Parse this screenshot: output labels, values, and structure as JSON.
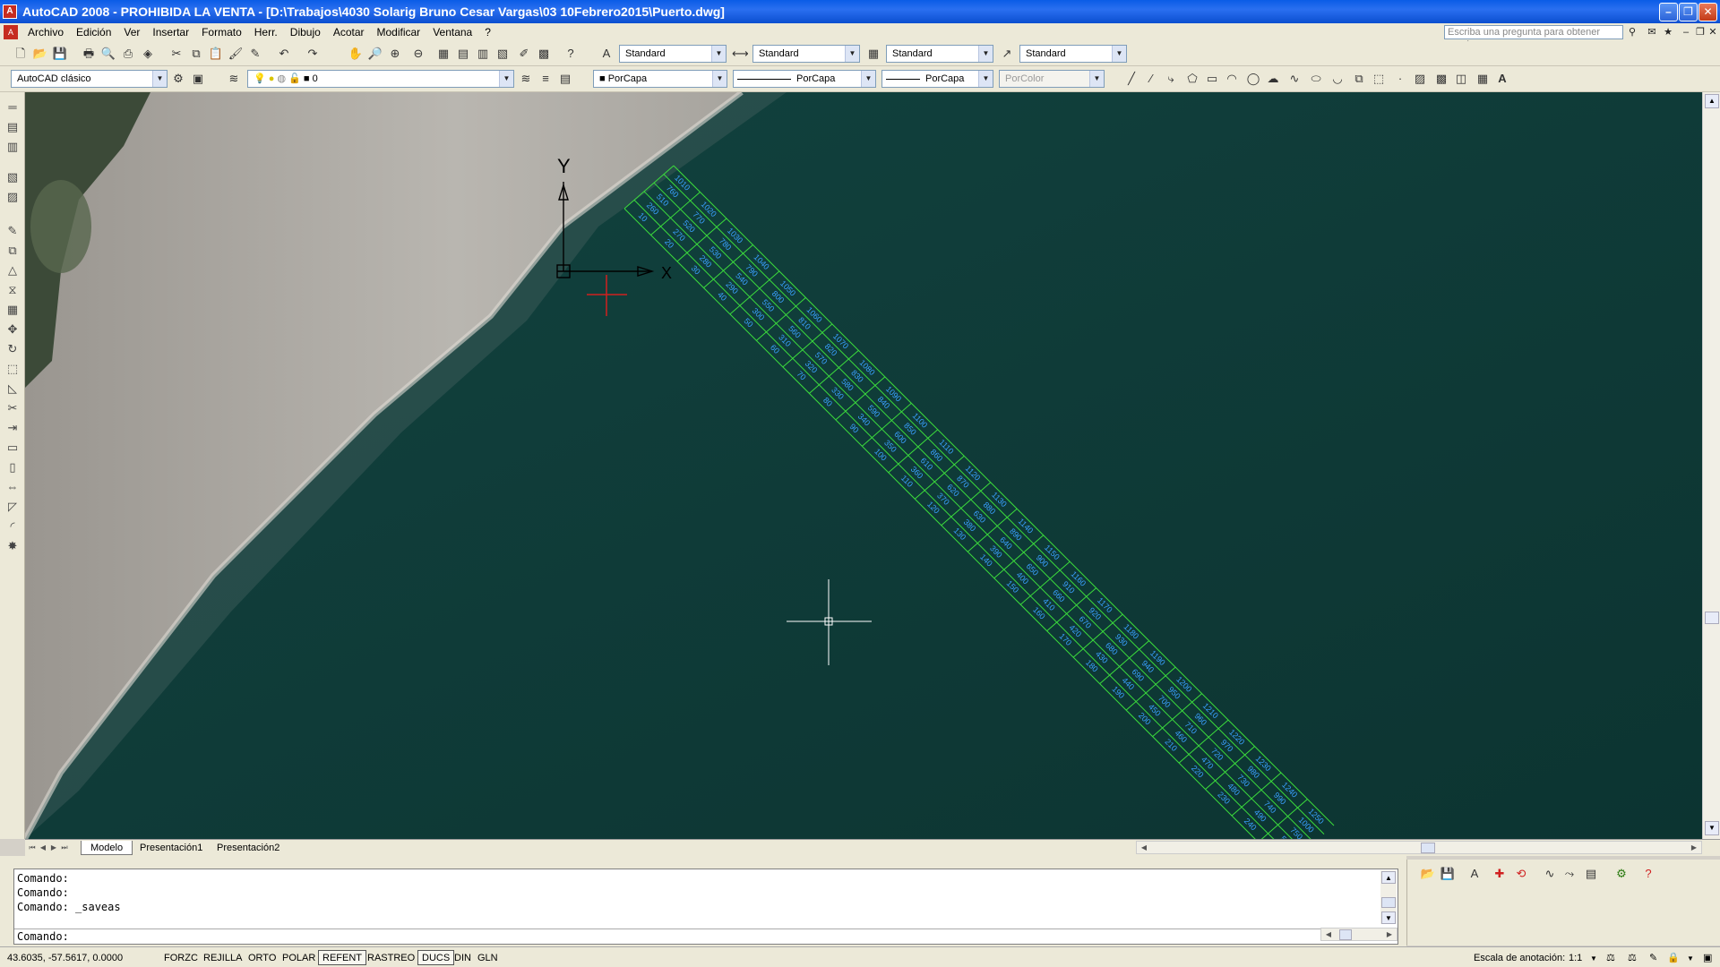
{
  "window": {
    "title": "AutoCAD 2008 - PROHIBIDA LA VENTA - [D:\\Trabajos\\4030 Solarig Bruno Cesar Vargas\\03 10Febrero2015\\Puerto.dwg]",
    "minimize": "–",
    "maximize": "❐",
    "close": "✕"
  },
  "menu": {
    "items": [
      "Archivo",
      "Edición",
      "Ver",
      "Insertar",
      "Formato",
      "Herr.",
      "Dibujo",
      "Acotar",
      "Modificar",
      "Ventana",
      "?"
    ],
    "help_placeholder": "Escriba una pregunta para obtener ayuda"
  },
  "toolbar1": {
    "text_style": "Standard",
    "dim_style": "Standard",
    "table_style": "Standard",
    "multileader_style": "Standard"
  },
  "toolbar2": {
    "workspace": "AutoCAD clásico",
    "layer": "0",
    "color": "PorCapa",
    "linetype": "PorCapa",
    "lineweight": "PorCapa",
    "plotstyle": "PorColor",
    "text_icon": "A"
  },
  "canvas": {
    "ucs_y": "Y",
    "ucs_x": "X",
    "grid_labels": [
      [
        "10",
        "20",
        "30",
        "40",
        "50",
        "60",
        "70",
        "80",
        "90",
        "100",
        "110",
        "120",
        "130",
        "140",
        "150",
        "160",
        "170",
        "180",
        "190",
        "200",
        "210",
        "220",
        "230",
        "240",
        "250"
      ],
      [
        "260",
        "270",
        "280",
        "290",
        "300",
        "310",
        "320",
        "330",
        "340",
        "350",
        "360",
        "370",
        "380",
        "390",
        "400",
        "410",
        "420",
        "430",
        "440",
        "450",
        "460",
        "470",
        "480",
        "490",
        "500"
      ],
      [
        "510",
        "520",
        "530",
        "540",
        "550",
        "560",
        "570",
        "580",
        "590",
        "600",
        "610",
        "620",
        "630",
        "640",
        "650",
        "660",
        "670",
        "680",
        "690",
        "700",
        "710",
        "720",
        "730",
        "740",
        "750"
      ],
      [
        "760",
        "770",
        "780",
        "790",
        "800",
        "810",
        "820",
        "830",
        "840",
        "850",
        "860",
        "870",
        "880",
        "890",
        "900",
        "910",
        "920",
        "930",
        "940",
        "950",
        "960",
        "970",
        "980",
        "990",
        "1000"
      ],
      [
        "1010",
        "1020",
        "1030",
        "1040",
        "1050",
        "1060",
        "1070",
        "1080",
        "1090",
        "1100",
        "1110",
        "1120",
        "1130",
        "1140",
        "1150",
        "1160",
        "1170",
        "1180",
        "1190",
        "1200",
        "1210",
        "1220",
        "1230",
        "1240",
        "1250"
      ]
    ]
  },
  "tabs": [
    "Modelo",
    "Presentación1",
    "Presentación2"
  ],
  "command": {
    "lines": [
      "Comando:",
      "Comando:",
      "Comando:  _saveas"
    ],
    "prompt": "Comando:"
  },
  "status": {
    "coords": "43.6035, -57.5617, 0.0000",
    "toggles": [
      {
        "label": "FORZC",
        "on": false
      },
      {
        "label": "REJILLA",
        "on": false
      },
      {
        "label": "ORTO",
        "on": false
      },
      {
        "label": "POLAR",
        "on": false
      },
      {
        "label": "REFENT",
        "on": true
      },
      {
        "label": "RASTREO",
        "on": false
      },
      {
        "label": "DUCS",
        "on": true
      },
      {
        "label": "DIN",
        "on": false
      },
      {
        "label": "GLN",
        "on": false
      }
    ],
    "annotation_scale_label": "Escala de anotación:",
    "annotation_scale": "1:1"
  }
}
